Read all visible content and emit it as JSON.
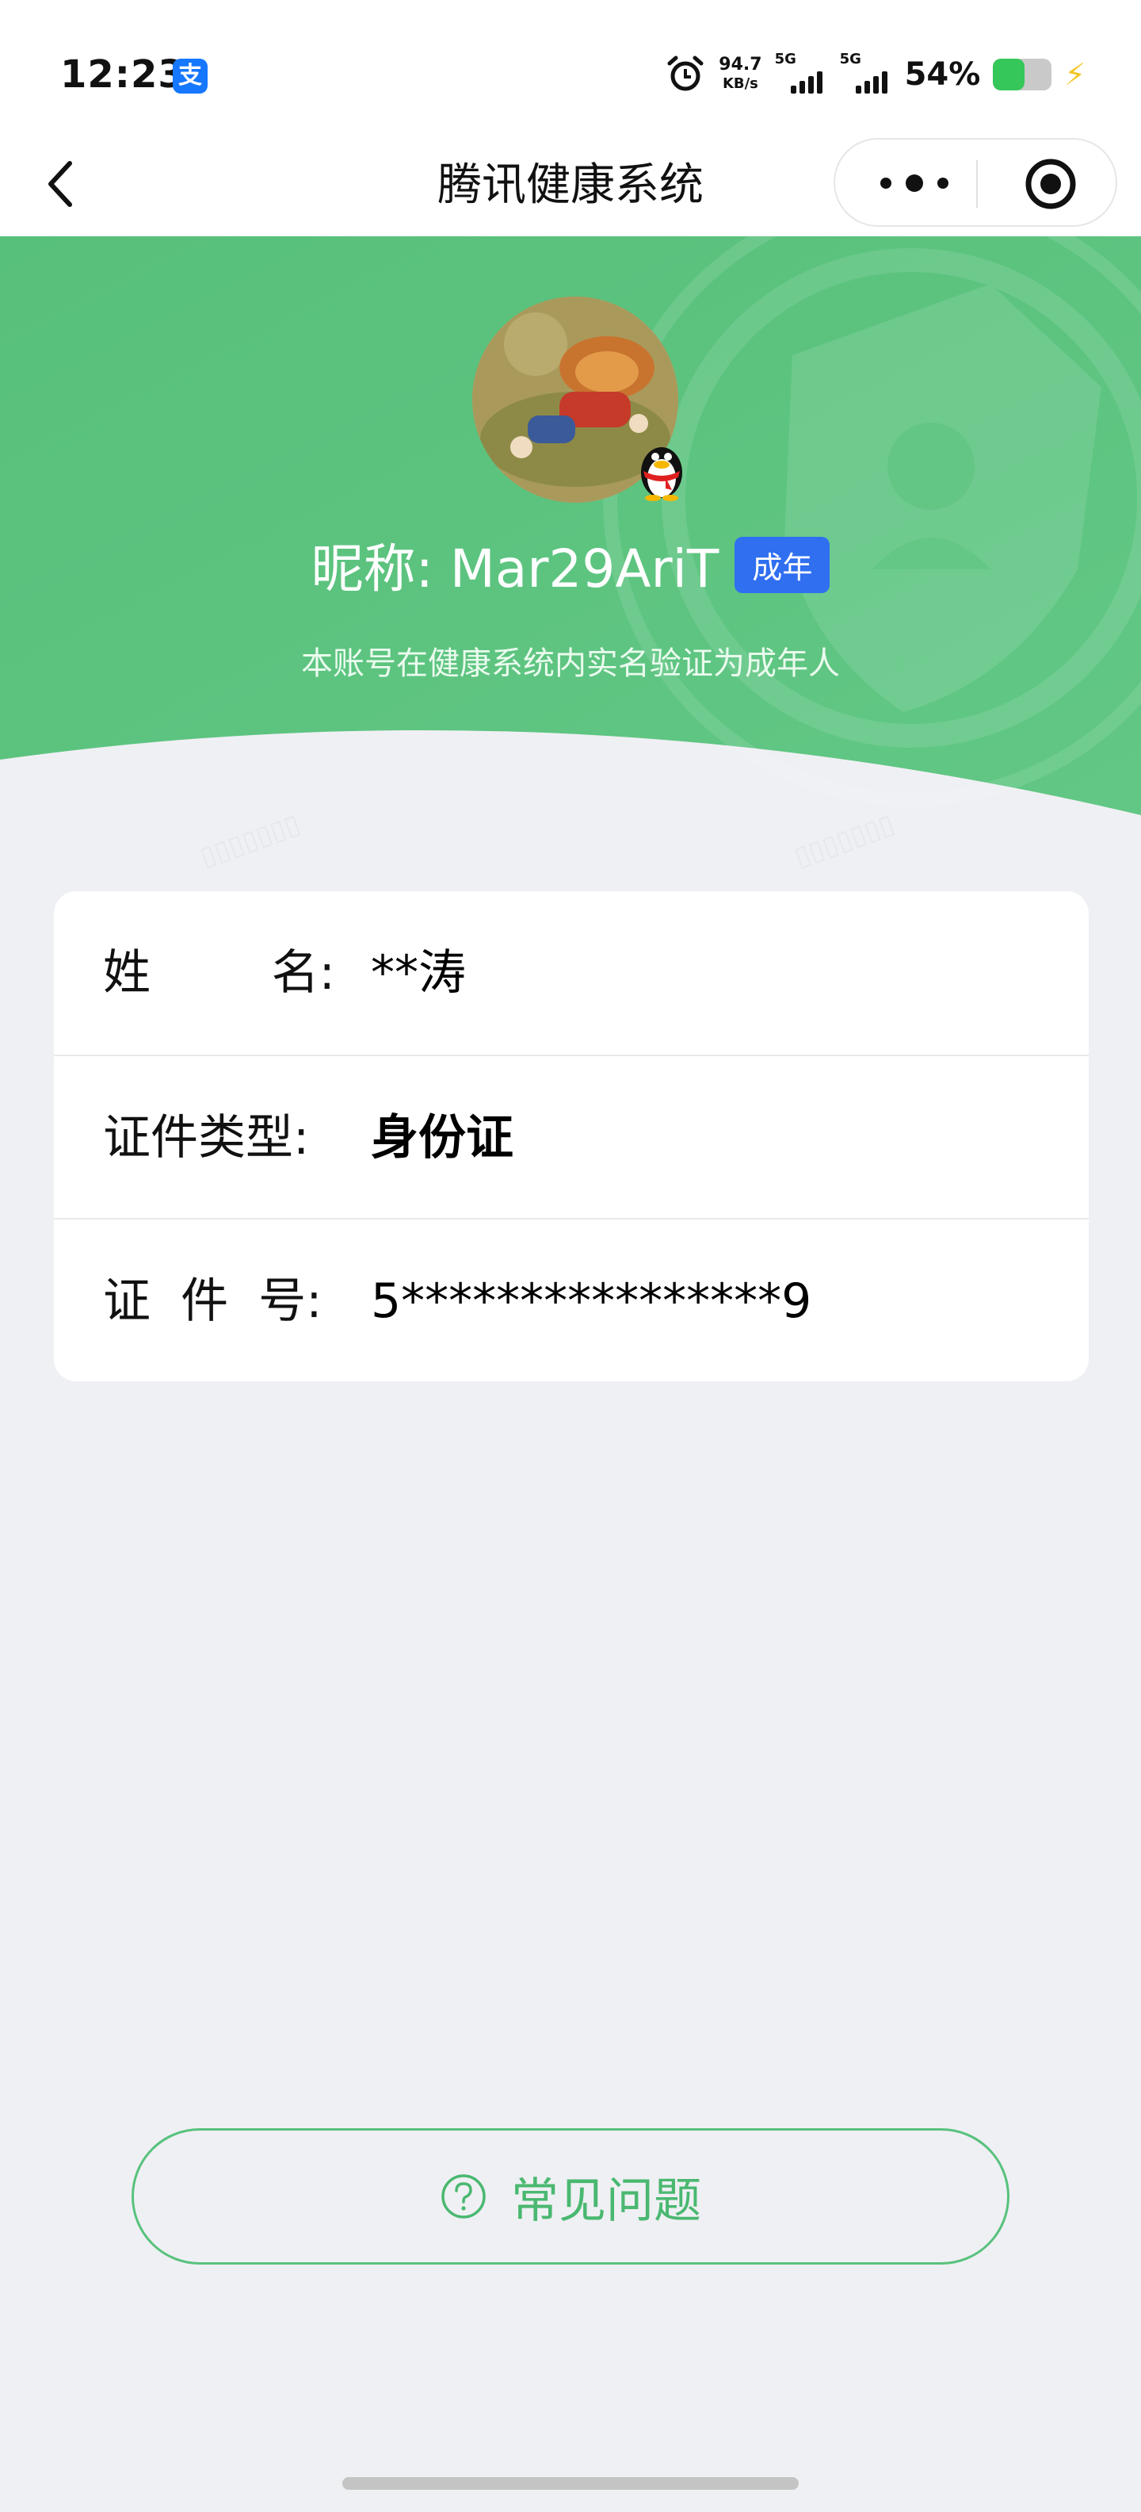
{
  "status_bar": {
    "time": "12:23",
    "app_badge": "支",
    "net_speed_value": "94.7",
    "net_speed_unit": "KB/s",
    "signal_1_label": "5G",
    "signal_2_label": "5G",
    "battery_percent_text": "54%",
    "battery_level": 0.54
  },
  "nav": {
    "title": "腾讯健康系统",
    "back_icon": "chevron-left-icon",
    "more_icon": "more-dots-icon",
    "close_icon": "target-icon"
  },
  "profile": {
    "nickname": "昵称: Mar29AriT",
    "badge": "成年",
    "verify_text": "本账号在健康系统内实名验证为成年人"
  },
  "info": {
    "rows": [
      {
        "label": "姓        名:",
        "value": "**涛"
      },
      {
        "label": "证件类型:",
        "value": "身份证"
      },
      {
        "label": "证  件  号:",
        "value": "5****************9"
      }
    ]
  },
  "faq": {
    "icon": "question-circle-icon",
    "label": "常见问题"
  },
  "colors": {
    "hero_green": "#5ec47f",
    "badge_blue": "#2f6ff0",
    "faq_green": "#4ab870",
    "page_bg": "#eff0f4"
  }
}
